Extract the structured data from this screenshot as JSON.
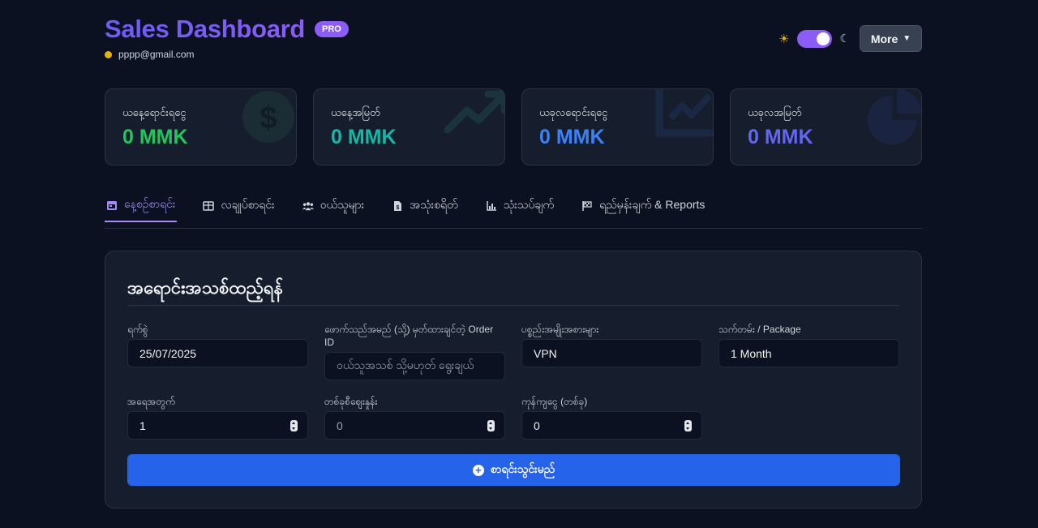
{
  "header": {
    "title": "Sales Dashboard",
    "badge": "PRO",
    "email": "pppp@gmail.com",
    "more_label": "More"
  },
  "cards": [
    {
      "label": "ယနေ့ရောင်းရငွေ",
      "value": "0 MMK",
      "color": "#22c55e",
      "icon": "dollar-icon"
    },
    {
      "label": "ယနေ့အမြတ်",
      "value": "0 MMK",
      "color": "#14b8a6",
      "icon": "trend-up-icon"
    },
    {
      "label": "ယခုလရောင်းရငွေ",
      "value": "0 MMK",
      "color": "#3b82f6",
      "icon": "line-chart-icon"
    },
    {
      "label": "ယခုလအမြတ်",
      "value": "0 MMK",
      "color": "#6366f1",
      "icon": "pie-chart-icon"
    }
  ],
  "tabs": [
    {
      "label": "နေ့စဉ်စာရင်း",
      "icon": "calendar-icon",
      "active": true
    },
    {
      "label": "လချုပ်စာရင်း",
      "icon": "table-icon",
      "active": false
    },
    {
      "label": "ဝယ်သူများ",
      "icon": "users-icon",
      "active": false
    },
    {
      "label": "အသုံးစရိတ်",
      "icon": "receipt-icon",
      "active": false
    },
    {
      "label": "သုံးသပ်ချက်",
      "icon": "chart-icon",
      "active": false
    },
    {
      "label": "ရည်မှန်းချက် & Reports",
      "icon": "flag-icon",
      "active": false
    }
  ],
  "form": {
    "title": "အရောင်းအသစ်ထည့်ရန်",
    "date_label": "ရက်စွဲ",
    "date_value": "25/07/2025",
    "customer_label": "ဖောက်သည်အမည် (သို့) မှတ်ထားချင်တဲ့ Order ID",
    "customer_placeholder": "ဝယ်သူအသစ် သို့မဟုတ် ရွေးချယ်",
    "product_label": "ပစ္စည်းအမျိုးအစားများ",
    "product_value": "VPN",
    "package_label": "သက်တမ်း / Package",
    "package_value": "1 Month",
    "qty_label": "အရေအတွက်",
    "qty_value": "1",
    "unit_price_label": "တစ်ခုစီဈေးနှုန်း",
    "unit_price_value": "0",
    "cost_label": "ကုန်ကျငွေ (တစ်ခု)",
    "cost_value": "0",
    "submit_label": "စာရင်းသွင်းမည်"
  },
  "colors": {
    "accent": "#8b5cf6",
    "primary_button": "#2563eb"
  }
}
